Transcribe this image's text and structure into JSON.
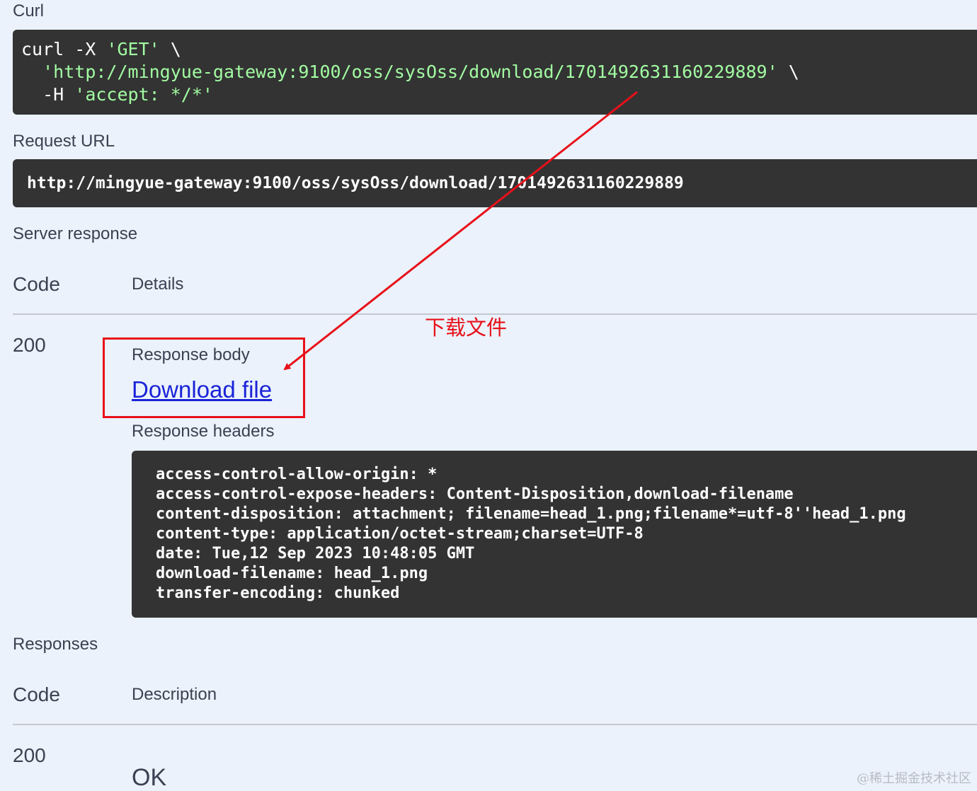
{
  "curl": {
    "label": "Curl",
    "line1_cmd": "curl -X ",
    "line1_method": "'GET'",
    "line1_tail": " \\",
    "line2_url": "'http://mingyue-gateway:9100/oss/sysOss/download/1701492631160229889'",
    "line2_tail": " \\",
    "line3_flag": "  -H ",
    "line3_header": "'accept: */*'"
  },
  "request_url": {
    "label": "Request URL",
    "value": "http://mingyue-gateway:9100/oss/sysOss/download/1701492631160229889"
  },
  "server_response": {
    "label": "Server response",
    "col_code": "Code",
    "col_details": "Details",
    "code": "200",
    "response_body_label": "Response body",
    "download_link": "Download file",
    "response_headers_label": "Response headers",
    "headers": [
      "access-control-allow-origin: *",
      "access-control-expose-headers: Content-Disposition,download-filename",
      "content-disposition: attachment; filename=head_1.png;filename*=utf-8''head_1.png",
      "content-type: application/octet-stream;charset=UTF-8",
      "date: Tue,12 Sep 2023 10:48:05 GMT",
      "download-filename: head_1.png",
      "transfer-encoding: chunked"
    ]
  },
  "responses": {
    "label": "Responses",
    "col_code": "Code",
    "col_description": "Description",
    "code": "200",
    "description": "OK"
  },
  "annotation": {
    "text": "下载文件",
    "color": "#e8101a"
  },
  "watermark": "@稀土掘金技术社区",
  "colors": {
    "background": "#ebf2fb",
    "code_background": "#333333",
    "string_green": "#a2fca2",
    "link_blue": "#1a23d8"
  }
}
